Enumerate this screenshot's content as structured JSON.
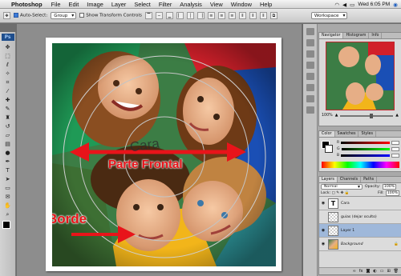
{
  "menubar": {
    "app_name": "Photoshop",
    "items": [
      "File",
      "Edit",
      "Image",
      "Layer",
      "Select",
      "Filter",
      "Analysis",
      "View",
      "Window",
      "Help"
    ],
    "clock": "Wed 6:05 PM"
  },
  "options_bar": {
    "auto_select_label": "Auto-Select:",
    "auto_select_value": "Group",
    "show_transform_label": "Show Transform Controls",
    "workspace_label": "Workspace"
  },
  "toolbox": {
    "logo": "Ps",
    "tools": [
      "move",
      "marquee",
      "lasso",
      "magic-wand",
      "crop",
      "eyedropper",
      "healing",
      "brush",
      "stamp",
      "history-brush",
      "eraser",
      "gradient",
      "dodge",
      "pen",
      "type",
      "path-select",
      "shape",
      "notes",
      "hand",
      "zoom"
    ]
  },
  "canvas": {
    "annotations": {
      "cara_text": "Cara",
      "frontal_text": "Parte Frontal",
      "borde_text": "Borde"
    },
    "annotation_color": "#e8141a"
  },
  "panels": {
    "navigator": {
      "tabs": [
        "Navigator",
        "Histogram",
        "Info"
      ],
      "zoom": "100%"
    },
    "color": {
      "tabs": [
        "Color",
        "Swatches",
        "Styles"
      ],
      "channels": [
        "R",
        "G",
        "B"
      ]
    },
    "layers": {
      "tabs": [
        "Layers",
        "Channels",
        "Paths"
      ],
      "blend_mode": "Normal",
      "opacity_label": "Opacity:",
      "opacity_value": "100%",
      "fill_label": "Fill:",
      "fill_value": "100%",
      "items": [
        {
          "name": "Cara",
          "type": "text"
        },
        {
          "name": "guias (dejar oculto)",
          "type": "raster"
        },
        {
          "name": "Layer 1",
          "type": "raster",
          "active": true
        },
        {
          "name": "Background",
          "type": "background"
        }
      ]
    }
  }
}
